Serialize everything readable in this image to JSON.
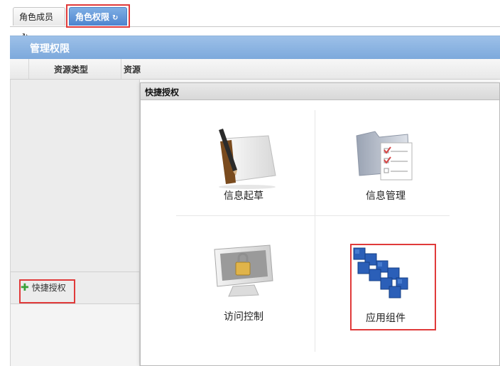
{
  "tabs": [
    {
      "label": "角色成员",
      "refresh_icon": "refresh-icon"
    },
    {
      "label": "角色权限",
      "refresh_icon": "refresh-icon"
    }
  ],
  "panel": {
    "title": "管理权限",
    "columns": [
      "资源类型",
      "资源"
    ]
  },
  "left_footer": {
    "quick_label": "快捷授权",
    "icon": "plus-icon"
  },
  "modal": {
    "title": "快捷授权",
    "tiles": [
      {
        "label": "信息起草",
        "icon": "notebook-pen-icon"
      },
      {
        "label": "信息管理",
        "icon": "folder-checklist-icon"
      },
      {
        "label": "访问控制",
        "icon": "monitor-lock-icon"
      },
      {
        "label": "应用组件",
        "icon": "blue-blocks-icon"
      }
    ]
  },
  "colors": {
    "accent": "#7da9dc",
    "active_tab": "#4d84cf",
    "highlight": "#e03a3a"
  }
}
